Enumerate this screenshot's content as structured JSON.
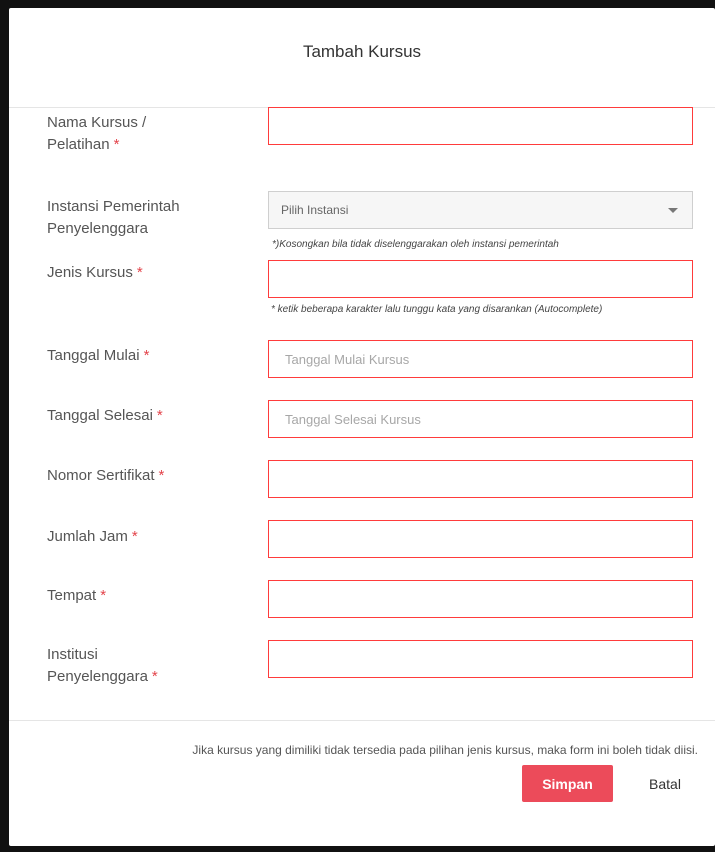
{
  "modal": {
    "title": "Tambah Kursus"
  },
  "fields": {
    "nama_kursus": {
      "label_line1": "Nama Kursus /",
      "label_line2": "Pelatihan",
      "required_mark": "*",
      "value": ""
    },
    "instansi": {
      "label_line1": "Instansi Pemerintah",
      "label_line2": "Penyelenggara",
      "selected": "Pilih Instansi",
      "hint": "*)Kosongkan bila tidak diselenggarakan oleh instansi pemerintah"
    },
    "jenis_kursus": {
      "label": "Jenis Kursus",
      "required_mark": "*",
      "value": "",
      "hint": "* ketik beberapa karakter lalu tunggu kata yang disarankan (Autocomplete)"
    },
    "tanggal_mulai": {
      "label": "Tanggal Mulai",
      "required_mark": "*",
      "placeholder": "Tanggal Mulai Kursus"
    },
    "tanggal_selesai": {
      "label": "Tanggal Selesai",
      "required_mark": "*",
      "placeholder": "Tanggal Selesai Kursus"
    },
    "nomor_sertifikat": {
      "label": "Nomor Sertifikat",
      "required_mark": "*",
      "value": ""
    },
    "jumlah_jam": {
      "label": "Jumlah Jam",
      "required_mark": "*",
      "value": ""
    },
    "tempat": {
      "label": "Tempat",
      "required_mark": "*",
      "value": ""
    },
    "institusi": {
      "label_line1": "Institusi",
      "label_line2": "Penyelenggara",
      "required_mark": "*",
      "value": ""
    }
  },
  "footer": {
    "note": "Jika kursus yang dimiliki tidak tersedia pada pilihan jenis kursus, maka form ini boleh tidak diisi.",
    "save_label": "Simpan",
    "cancel_label": "Batal"
  },
  "colors": {
    "error_border": "#ff3b3b",
    "required_mark": "#e3434a",
    "primary_button": "#ec4b5a"
  }
}
